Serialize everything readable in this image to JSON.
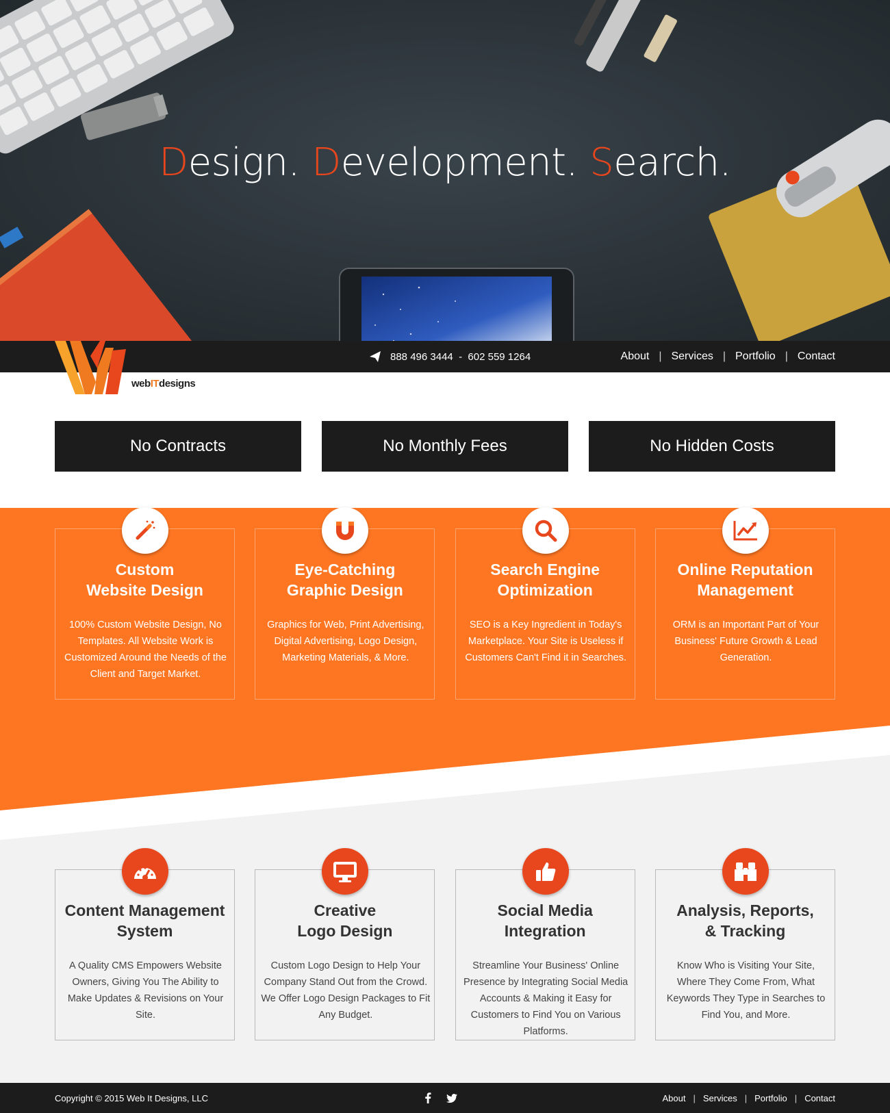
{
  "hero": {
    "title_parts": [
      {
        "cap": "D",
        "rest": "esign. "
      },
      {
        "cap": "D",
        "rest": "evelopment. "
      },
      {
        "cap": "S",
        "rest": "earch."
      }
    ]
  },
  "header": {
    "phone_icon": "paper-plane-icon",
    "phone": "888 496 3444  -  602 559 1264",
    "nav": [
      "About",
      "Services",
      "Portfolio",
      "Contact"
    ],
    "nav_separator": "|"
  },
  "logo": {
    "brand_prefix": "web",
    "brand_highlight": "IT",
    "brand_suffix": "designs"
  },
  "features": [
    "No Contracts",
    "No Monthly Fees",
    "No Hidden Costs"
  ],
  "services_primary": [
    {
      "icon": "magic-wand-icon",
      "title": "Custom\nWebsite Design",
      "desc": "100% Custom Website Design, No Templates. All Website Work is Customized Around the Needs of the Client and Target Market."
    },
    {
      "icon": "magnet-icon",
      "title": "Eye-Catching\nGraphic Design",
      "desc": "Graphics for Web, Print Advertising, Digital Advertising, Logo Design, Marketing Materials, & More."
    },
    {
      "icon": "search-icon",
      "title": "Search Engine\nOptimization",
      "desc": "SEO is a Key Ingredient in Today's Marketplace. Your Site is Useless if Customers Can't Find it in Searches."
    },
    {
      "icon": "line-chart-icon",
      "title": "Online Reputation\nManagement",
      "desc": "ORM is an Important Part of Your Business' Future Growth & Lead Generation."
    }
  ],
  "services_secondary": [
    {
      "icon": "dashboard-icon",
      "title": "Content Management\nSystem",
      "desc": "A Quality CMS Empowers Website Owners, Giving You The Ability to Make Updates & Revisions on Your Site."
    },
    {
      "icon": "monitor-icon",
      "title": "Creative\nLogo Design",
      "desc": "Custom Logo Design to Help Your Company Stand Out from the Crowd. We Offer Logo Design Packages to Fit Any Budget."
    },
    {
      "icon": "thumbs-up-icon",
      "title": "Social Media\nIntegration",
      "desc": "Streamline Your Business' Online Presence by Integrating Social Media Accounts & Making it Easy for Customers to Find You on Various Platforms."
    },
    {
      "icon": "binoculars-icon",
      "title": "Analysis, Reports,\n& Tracking",
      "desc": "Know Who is Visiting Your Site, Where They Come From, What Keywords They Type in Searches to Find You, and More."
    }
  ],
  "footer": {
    "copyright": "Copyright © 2015  Web It Designs, LLC",
    "social": [
      "facebook-icon",
      "twitter-icon"
    ],
    "nav": [
      "About",
      "Services",
      "Portfolio",
      "Contact"
    ],
    "nav_separator": "|"
  },
  "colors": {
    "accent": "#e8461c",
    "orange": "#fe7622",
    "dark": "#1c1c1c",
    "light_grey": "#f2f2f2"
  }
}
